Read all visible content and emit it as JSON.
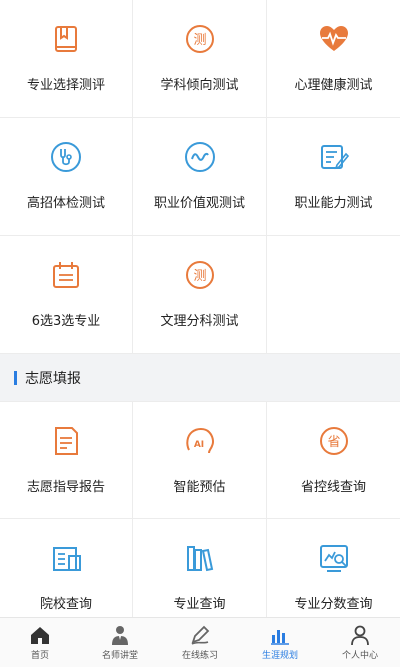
{
  "colors": {
    "orange": "#e87a3c",
    "blue": "#3a9ad9",
    "accent": "#2a7de1",
    "gray": "#555555"
  },
  "tests": [
    {
      "label": "专业选择测评",
      "icon": "book-icon"
    },
    {
      "label": "学科倾向测试",
      "icon": "test-badge-icon"
    },
    {
      "label": "心理健康测试",
      "icon": "heartbeat-icon"
    },
    {
      "label": "高招体检测试",
      "icon": "stethoscope-icon"
    },
    {
      "label": "职业价值观测试",
      "icon": "wave-circle-icon"
    },
    {
      "label": "职业能力测试",
      "icon": "form-edit-icon"
    },
    {
      "label": "6选3选专业",
      "icon": "calendar-icon"
    },
    {
      "label": "文理分科测试",
      "icon": "test-badge-icon"
    }
  ],
  "section": {
    "title": "志愿填报"
  },
  "volunteer": [
    {
      "label": "志愿指导报告",
      "icon": "report-icon"
    },
    {
      "label": "智能预估",
      "icon": "ai-brain-icon"
    },
    {
      "label": "省控线查询",
      "icon": "province-badge-icon"
    },
    {
      "label": "院校查询",
      "icon": "school-icon"
    },
    {
      "label": "专业查询",
      "icon": "books-icon"
    },
    {
      "label": "专业分数查询",
      "icon": "score-search-icon"
    }
  ],
  "badges": {
    "test": "测",
    "province": "省",
    "ai": "AI"
  },
  "tabs": [
    {
      "label": "首页",
      "icon": "home-icon",
      "active": false
    },
    {
      "label": "名师讲堂",
      "icon": "teacher-icon",
      "active": false
    },
    {
      "label": "在线练习",
      "icon": "pen-icon",
      "active": false
    },
    {
      "label": "生涯规划",
      "icon": "bar-chart-icon",
      "active": true
    },
    {
      "label": "个人中心",
      "icon": "user-icon",
      "active": false
    }
  ]
}
